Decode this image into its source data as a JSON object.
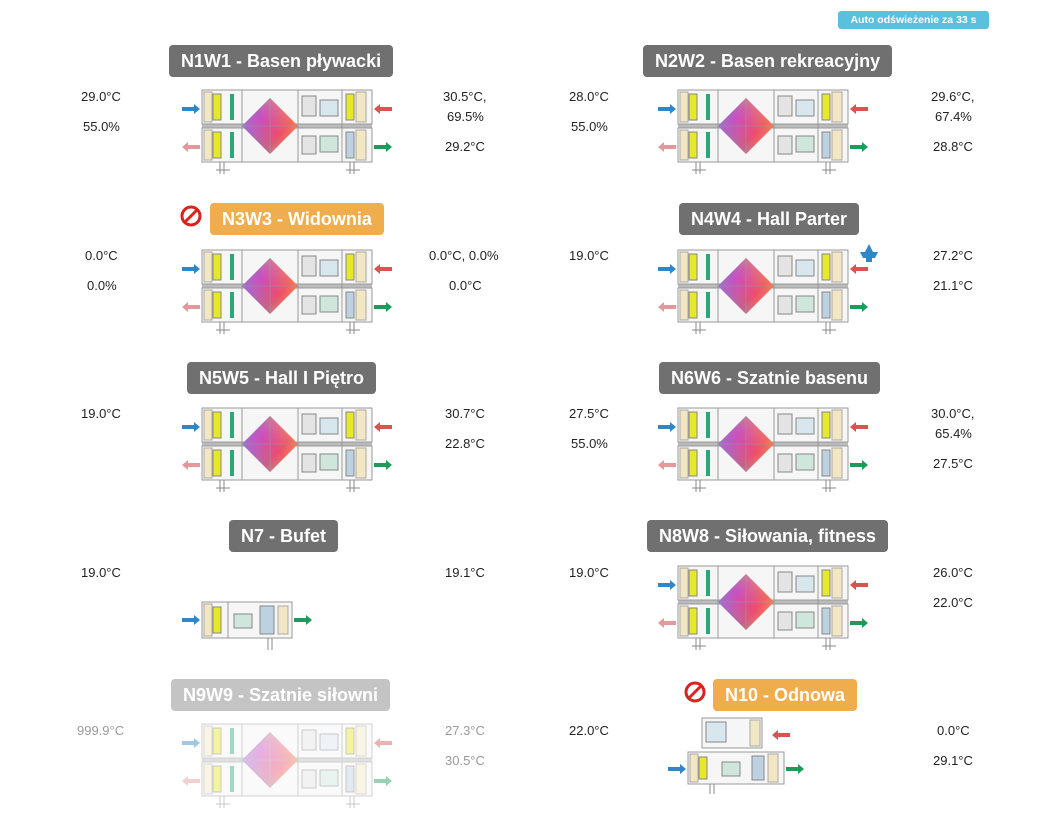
{
  "refresh_label": "Auto odświeżenie za 33 s",
  "units": [
    {
      "id": "u1",
      "title": "N1W1 - Basen pływacki",
      "style": "grey",
      "disabled": false,
      "left": [
        "29.0°C",
        "55.0%"
      ],
      "right": [
        "30.5°C,",
        "69.5%",
        "29.2°C"
      ]
    },
    {
      "id": "u2",
      "title": "N2W2 - Basen rekreacyjny",
      "style": "grey",
      "disabled": false,
      "left": [
        "28.0°C",
        "55.0%"
      ],
      "right": [
        "29.6°C,",
        "67.4%",
        "28.8°C"
      ]
    },
    {
      "id": "u3",
      "title": "N3W3 - Widownia",
      "style": "orange",
      "disabled": true,
      "left": [
        "0.0°C",
        "0.0%"
      ],
      "right": [
        "0.0°C, 0.0%",
        "0.0°C"
      ]
    },
    {
      "id": "u4",
      "title": "N4W4 - Hall Parter",
      "style": "grey",
      "disabled": false,
      "left": [
        "19.0°C"
      ],
      "right": [
        "27.2°C",
        "21.1°C"
      ]
    },
    {
      "id": "u5",
      "title": "N5W5 - Hall I Piętro",
      "style": "grey",
      "disabled": false,
      "left": [
        "19.0°C"
      ],
      "right": [
        "30.7°C",
        "22.8°C"
      ]
    },
    {
      "id": "u6",
      "title": "N6W6 - Szatnie basenu",
      "style": "grey",
      "disabled": false,
      "left": [
        "27.5°C",
        "55.0%"
      ],
      "right": [
        "30.0°C,",
        "65.4%",
        "27.5°C"
      ]
    },
    {
      "id": "u7",
      "title": "N7 - Bufet",
      "style": "grey",
      "disabled": false,
      "left": [
        "19.0°C"
      ],
      "right": [
        "19.1°C"
      ]
    },
    {
      "id": "u8",
      "title": "N8W8 - Siłowania, fitness",
      "style": "grey",
      "disabled": false,
      "left": [
        "19.0°C"
      ],
      "right": [
        "26.0°C",
        "22.0°C"
      ]
    },
    {
      "id": "u9",
      "title": "N9W9 - Szatnie siłowni",
      "style": "lightgrey",
      "disabled": false,
      "left": [
        "999.9°C"
      ],
      "right": [
        "27.3°C",
        "30.5°C"
      ]
    },
    {
      "id": "u10",
      "title": "N10 - Odnowa",
      "style": "orange",
      "disabled": true,
      "left": [
        "22.0°C"
      ],
      "right": [
        "0.0°C",
        "29.1°C"
      ]
    }
  ],
  "colors": {
    "accent": "#5bc0de",
    "grey": "#707070",
    "orange": "#efad4d",
    "ban": "#d9231d"
  }
}
